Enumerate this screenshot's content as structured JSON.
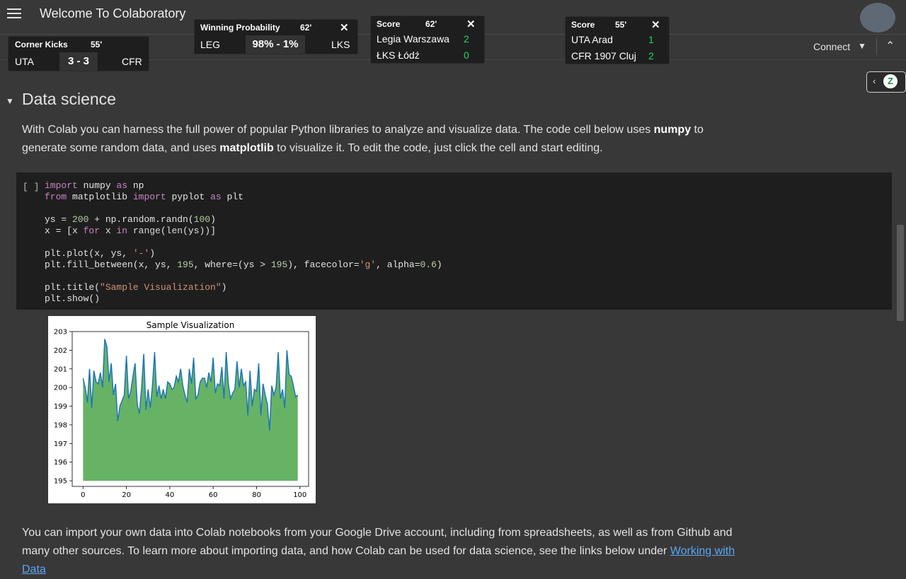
{
  "header": {
    "title": "Welcome To Colaboratory"
  },
  "toolbar": {
    "connect_label": "Connect"
  },
  "widgets": {
    "corner": {
      "label": "Corner Kicks",
      "minute": "55'",
      "home": "UTA",
      "score": "3 - 3",
      "away": "CFR"
    },
    "winprob": {
      "label": "Winning Probability",
      "minute": "62'",
      "home": "LEG",
      "value": "98% - 1%",
      "away": "LKS"
    },
    "score1": {
      "label": "Score",
      "minute": "62'",
      "team1": "Legia Warszawa",
      "score1": "2",
      "team2": "ŁKS Łódź",
      "score2": "0"
    },
    "score2": {
      "label": "Score",
      "minute": "55'",
      "team1": "UTA Arad",
      "score1": "1",
      "team2": "CFR 1907 Cluj",
      "score2": "2"
    }
  },
  "section": {
    "title": "Data science",
    "intro": {
      "t1": "With Colab you can harness the full power of popular Python libraries to analyze and visualize data. The code cell below uses ",
      "b1": "numpy",
      "t2": " to generate some random data, and uses ",
      "b2": "matplotlib",
      "t3": " to visualize it. To edit the code, just click the cell and start editing."
    },
    "run_bracket": "[ ]",
    "outro": {
      "text": "You can import your own data into Colab notebooks from your Google Drive account, including from spreadsheets, as well as from Github and many other sources. To learn more about importing data, and how Colab can be used for data science, see the links below under ",
      "link": "Working with Data"
    }
  },
  "chart_data": {
    "type": "area",
    "title": "Sample Visualization",
    "xlabel": "",
    "ylabel": "",
    "xlim": [
      -5,
      104
    ],
    "ylim": [
      194.7,
      203
    ],
    "fill_baseline": 195,
    "line_color": "#1f77b4",
    "fill_color": "#008000",
    "xticks": [
      0,
      20,
      40,
      60,
      80,
      100
    ],
    "yticks": [
      195,
      196,
      197,
      198,
      199,
      200,
      201,
      202,
      203
    ],
    "x": [
      0,
      1,
      2,
      3,
      4,
      5,
      6,
      7,
      8,
      9,
      10,
      11,
      12,
      13,
      14,
      15,
      16,
      17,
      18,
      19,
      20,
      21,
      22,
      23,
      24,
      25,
      26,
      27,
      28,
      29,
      30,
      31,
      32,
      33,
      34,
      35,
      36,
      37,
      38,
      39,
      40,
      41,
      42,
      43,
      44,
      45,
      46,
      47,
      48,
      49,
      50,
      51,
      52,
      53,
      54,
      55,
      56,
      57,
      58,
      59,
      60,
      61,
      62,
      63,
      64,
      65,
      66,
      67,
      68,
      69,
      70,
      71,
      72,
      73,
      74,
      75,
      76,
      77,
      78,
      79,
      80,
      81,
      82,
      83,
      84,
      85,
      86,
      87,
      88,
      89,
      90,
      91,
      92,
      93,
      94,
      95,
      96,
      97,
      98,
      99
    ],
    "y": [
      200.5,
      200.0,
      199.2,
      201.0,
      198.9,
      200.9,
      200.3,
      200.2,
      200.8,
      200.0,
      202.6,
      202.2,
      200.3,
      201.3,
      199.6,
      200.2,
      198.2,
      199.0,
      199.3,
      199.6,
      201.7,
      199.4,
      199.8,
      200.6,
      201.3,
      199.1,
      198.6,
      200.0,
      201.8,
      198.8,
      199.9,
      198.9,
      200.1,
      201.9,
      199.5,
      200.1,
      199.4,
      199.9,
      199.4,
      200.3,
      200.2,
      199.9,
      200.0,
      200.6,
      200.3,
      201.0,
      200.1,
      199.6,
      199.2,
      201.0,
      200.2,
      201.6,
      199.4,
      199.6,
      200.3,
      200.5,
      200.5,
      200.0,
      200.8,
      200.3,
      201.6,
      199.7,
      200.2,
      200.1,
      201.1,
      199.4,
      201.9,
      200.2,
      199.4,
      199.7,
      199.9,
      201.4,
      200.0,
      201.0,
      200.1,
      200.3,
      198.5,
      200.9,
      199.0,
      199.9,
      199.8,
      201.3,
      198.5,
      200.2,
      199.6,
      199.1,
      197.7,
      200.1,
      199.6,
      200.0,
      201.9,
      199.4,
      199.9,
      198.9,
      202.0,
      200.7,
      200.6,
      200.1,
      199.5,
      199.6
    ]
  }
}
